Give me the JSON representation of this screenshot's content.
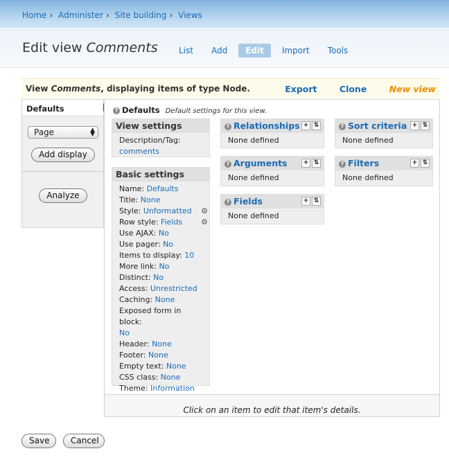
{
  "breadcrumbs": [
    "Home",
    "Administer",
    "Site building",
    "Views"
  ],
  "page": {
    "title_prefix": "Edit view",
    "title_view": "Comments"
  },
  "tabs": [
    "List",
    "Add",
    "Edit",
    "Import",
    "Tools"
  ],
  "viewbar": {
    "text_prefix": "View",
    "view_name": "Comments",
    "text_suffix": ", displaying items of type Node.",
    "links": [
      "Export",
      "Clone",
      "New view"
    ]
  },
  "left": {
    "tab": "Defaults",
    "select_value": "Page",
    "add_display": "Add display",
    "analyze": "Analyze"
  },
  "panel": {
    "heading": "Defaults",
    "subheading": "Default settings for this view.",
    "view_settings": {
      "title": "View settings",
      "label": "Description/Tag:",
      "value": "comments"
    },
    "basic_settings": {
      "title": "Basic settings",
      "rows": [
        {
          "label": "Name:",
          "value": "Defaults"
        },
        {
          "label": "Title:",
          "value": "None"
        },
        {
          "label": "Style:",
          "value": "Unformatted"
        },
        {
          "label": "Row style:",
          "value": "Fields"
        },
        {
          "label": "Use AJAX:",
          "value": "No"
        },
        {
          "label": "Use pager:",
          "value": "No"
        },
        {
          "label": "Items to display:",
          "value": "10"
        },
        {
          "label": "More link:",
          "value": "No"
        },
        {
          "label": "Distinct:",
          "value": "No"
        },
        {
          "label": "Access:",
          "value": "Unrestricted"
        },
        {
          "label": "Caching:",
          "value": "None"
        },
        {
          "label": "Exposed form in block:",
          "value": "No"
        },
        {
          "label": "Header:",
          "value": "None"
        },
        {
          "label": "Footer:",
          "value": "None"
        },
        {
          "label": "Empty text:",
          "value": "None"
        },
        {
          "label": "CSS class:",
          "value": "None"
        },
        {
          "label": "Theme:",
          "value": "Information"
        }
      ]
    },
    "relationships": {
      "title": "Relationships",
      "body": "None defined"
    },
    "arguments": {
      "title": "Arguments",
      "body": "None defined"
    },
    "fields": {
      "title": "Fields",
      "body": "None defined"
    },
    "sort_criteria": {
      "title": "Sort criteria",
      "body": "None defined"
    },
    "filters": {
      "title": "Filters",
      "body": "None defined"
    },
    "footer_message": "Click on an item to edit that item's details."
  },
  "buttons": {
    "save": "Save",
    "cancel": "Cancel"
  },
  "colors": {
    "link": "#1a6bb5",
    "new_view": "#f08c00",
    "active_tab": "#a9cbe6"
  }
}
